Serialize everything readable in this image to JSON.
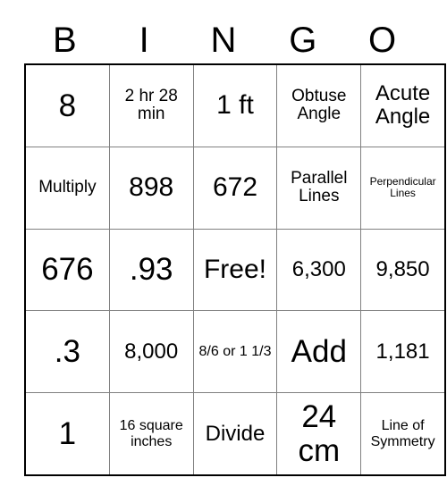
{
  "card": {
    "title": "BINGO",
    "headers": [
      "B",
      "I",
      "N",
      "G",
      "O"
    ],
    "rows": [
      [
        {
          "text": "8",
          "size": "fs-xl"
        },
        {
          "text": "2 hr 28 min",
          "size": "fs-sm"
        },
        {
          "text": "1 ft",
          "size": "fs-lg"
        },
        {
          "text": "Obtuse Angle",
          "size": "fs-sm"
        },
        {
          "text": "Acute Angle",
          "size": "fs-md"
        }
      ],
      [
        {
          "text": "Multiply",
          "size": "fs-sm"
        },
        {
          "text": "898",
          "size": "fs-lg"
        },
        {
          "text": "672",
          "size": "fs-lg"
        },
        {
          "text": "Parallel Lines",
          "size": "fs-sm"
        },
        {
          "text": "Perpendicular Lines",
          "size": "fs-xxs"
        }
      ],
      [
        {
          "text": "676",
          "size": "fs-xl"
        },
        {
          "text": ".93",
          "size": "fs-xl"
        },
        {
          "text": "Free!",
          "size": "fs-lg"
        },
        {
          "text": "6,300",
          "size": "fs-md"
        },
        {
          "text": "9,850",
          "size": "fs-md"
        }
      ],
      [
        {
          "text": ".3",
          "size": "fs-xl"
        },
        {
          "text": "8,000",
          "size": "fs-md"
        },
        {
          "text": "8/6 or 1 1/3",
          "size": "fs-xs"
        },
        {
          "text": "Add",
          "size": "fs-xl"
        },
        {
          "text": "1,181",
          "size": "fs-md"
        }
      ],
      [
        {
          "text": "1",
          "size": "fs-xl"
        },
        {
          "text": "16 square inches",
          "size": "fs-xs"
        },
        {
          "text": "Divide",
          "size": "fs-md"
        },
        {
          "text": "24 cm",
          "size": "fs-xl"
        },
        {
          "text": "Line of Symmetry",
          "size": "fs-xs"
        }
      ]
    ]
  }
}
